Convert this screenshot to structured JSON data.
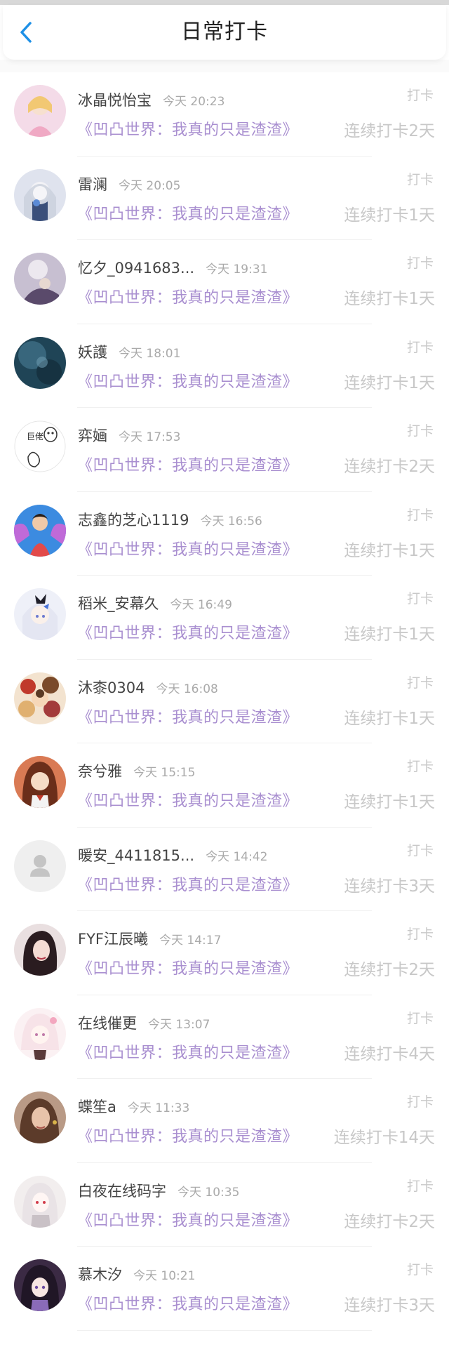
{
  "header": {
    "title": "日常打卡",
    "back_icon": "chevron-left-icon"
  },
  "items": [
    {
      "name": "冰晶悦怡宝",
      "time": "今天 20:23",
      "book": "《凹凸世界：我真的只是渣渣》",
      "punch": "打卡",
      "streak": "连续打卡2天"
    },
    {
      "name": "雷澜",
      "time": "今天 20:05",
      "book": "《凹凸世界：我真的只是渣渣》",
      "punch": "打卡",
      "streak": "连续打卡1天"
    },
    {
      "name": "忆夕_0941683...",
      "time": "今天 19:31",
      "book": "《凹凸世界：我真的只是渣渣》",
      "punch": "打卡",
      "streak": "连续打卡1天"
    },
    {
      "name": "妖護",
      "time": "今天 18:01",
      "book": "《凹凸世界：我真的只是渣渣》",
      "punch": "打卡",
      "streak": "连续打卡1天"
    },
    {
      "name": "弈婳",
      "time": "今天 17:53",
      "book": "《凹凸世界：我真的只是渣渣》",
      "punch": "打卡",
      "streak": "连续打卡2天",
      "avatar_text": "巨佬"
    },
    {
      "name": "志鑫的芝心1119",
      "time": "今天 16:56",
      "book": "《凹凸世界：我真的只是渣渣》",
      "punch": "打卡",
      "streak": "连续打卡1天"
    },
    {
      "name": "稻米_安幕久",
      "time": "今天 16:49",
      "book": "《凹凸世界：我真的只是渣渣》",
      "punch": "打卡",
      "streak": "连续打卡1天"
    },
    {
      "name": "沐桼0304",
      "time": "今天 16:08",
      "book": "《凹凸世界：我真的只是渣渣》",
      "punch": "打卡",
      "streak": "连续打卡1天"
    },
    {
      "name": "奈兮雅",
      "time": "今天 15:15",
      "book": "《凹凸世界：我真的只是渣渣》",
      "punch": "打卡",
      "streak": "连续打卡1天"
    },
    {
      "name": "暖安_4411815...",
      "time": "今天 14:42",
      "book": "《凹凸世界：我真的只是渣渣》",
      "punch": "打卡",
      "streak": "连续打卡3天"
    },
    {
      "name": "FYF江辰曦",
      "time": "今天 14:17",
      "book": "《凹凸世界：我真的只是渣渣》",
      "punch": "打卡",
      "streak": "连续打卡2天"
    },
    {
      "name": "在线催更",
      "time": "今天 13:07",
      "book": "《凹凸世界：我真的只是渣渣》",
      "punch": "打卡",
      "streak": "连续打卡4天"
    },
    {
      "name": "蝶笙a",
      "time": "今天 11:33",
      "book": "《凹凸世界：我真的只是渣渣》",
      "punch": "打卡",
      "streak": "连续打卡14天"
    },
    {
      "name": "白夜在线码字",
      "time": "今天 10:35",
      "book": "《凹凸世界：我真的只是渣渣》",
      "punch": "打卡",
      "streak": "连续打卡2天"
    },
    {
      "name": "慕木汐",
      "time": "今天 10:21",
      "book": "《凹凸世界：我真的只是渣渣》",
      "punch": "打卡",
      "streak": "连续打卡3天"
    }
  ]
}
